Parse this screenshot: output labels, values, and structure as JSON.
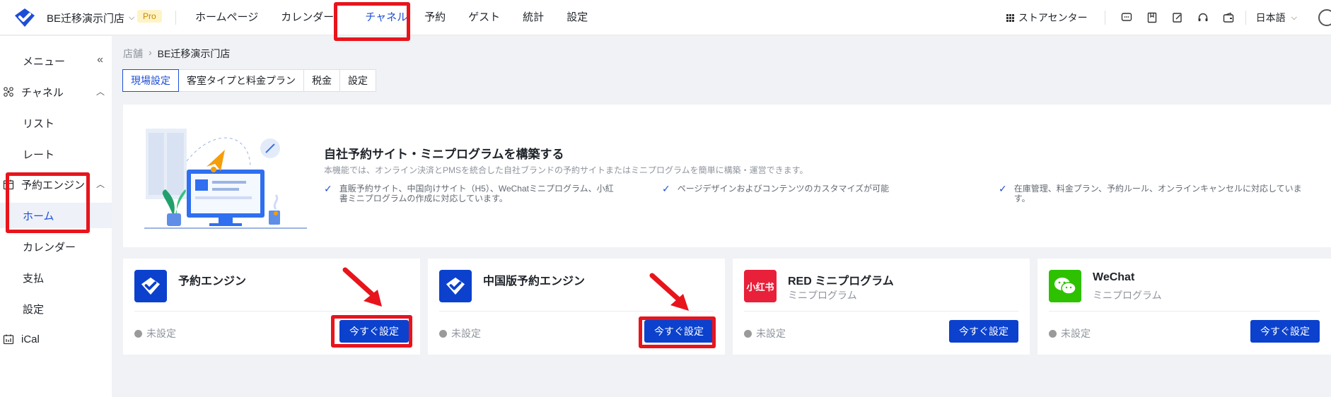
{
  "topbar": {
    "hotel_name": "BE迁移演示门店",
    "plan_badge": "Pro",
    "nav": [
      "ホームページ",
      "カレンダー",
      "チャネル",
      "予約",
      "ゲスト",
      "統計",
      "設定"
    ],
    "active_nav": "チャネル",
    "store_center": "ストアセンター",
    "language": "日本語"
  },
  "sidebar": {
    "menu_label": "メニュー",
    "items": [
      {
        "label": "チャネル",
        "type": "parent"
      },
      {
        "label": "リスト",
        "type": "sub"
      },
      {
        "label": "レート",
        "type": "sub"
      },
      {
        "label": "予約エンジン",
        "type": "parent"
      },
      {
        "label": "ホーム",
        "type": "sub",
        "selected": true
      },
      {
        "label": "カレンダー",
        "type": "sub"
      },
      {
        "label": "支払",
        "type": "sub"
      },
      {
        "label": "設定",
        "type": "sub"
      },
      {
        "label": "iCal",
        "type": "parent"
      }
    ]
  },
  "breadcrumb": {
    "root": "店舗",
    "current": "BE迁移演示门店"
  },
  "tabs": [
    "現場設定",
    "客室タイプと料金プラン",
    "税金",
    "設定"
  ],
  "hero": {
    "title": "自社予約サイト・ミニプログラムを構築する",
    "description": "本機能では、オンライン決済とPMSを統合した自社ブランドの予約サイトまたはミニプログラムを簡単に構築・運営できます。",
    "features": [
      "直販予約サイト、中国向けサイト（H5）、WeChatミニプログラム、小紅書ミニプログラムの作成に対応しています。",
      "ページデザインおよびコンテンツのカスタマイズが可能",
      "在庫管理、料金プラン、予約ルール、オンラインキャンセルに対応しています。"
    ]
  },
  "cards": [
    {
      "title": "予約エンジン",
      "subtitle": "",
      "status": "未設定",
      "button": "今すぐ設定",
      "logo": "brand-logo-icon"
    },
    {
      "title": "中国版予約エンジン",
      "subtitle": "",
      "status": "未設定",
      "button": "今すぐ設定",
      "logo": "brand-logo-icon"
    },
    {
      "title": "RED ミニプログラム",
      "subtitle": "ミニプログラム",
      "status": "未設定",
      "button": "今すぐ設定",
      "logo": "xiaohongshu-logo-icon",
      "logo_text": "小红书"
    },
    {
      "title": "WeChat",
      "subtitle": "ミニプログラム",
      "status": "未設定",
      "button": "今すぐ設定",
      "logo": "wechat-logo-icon"
    }
  ],
  "colors": {
    "accent": "#1d4ed8",
    "button": "#0b41cd",
    "highlight": "#e8141c",
    "red_brand": "#e8203a",
    "wechat": "#2dc100"
  }
}
